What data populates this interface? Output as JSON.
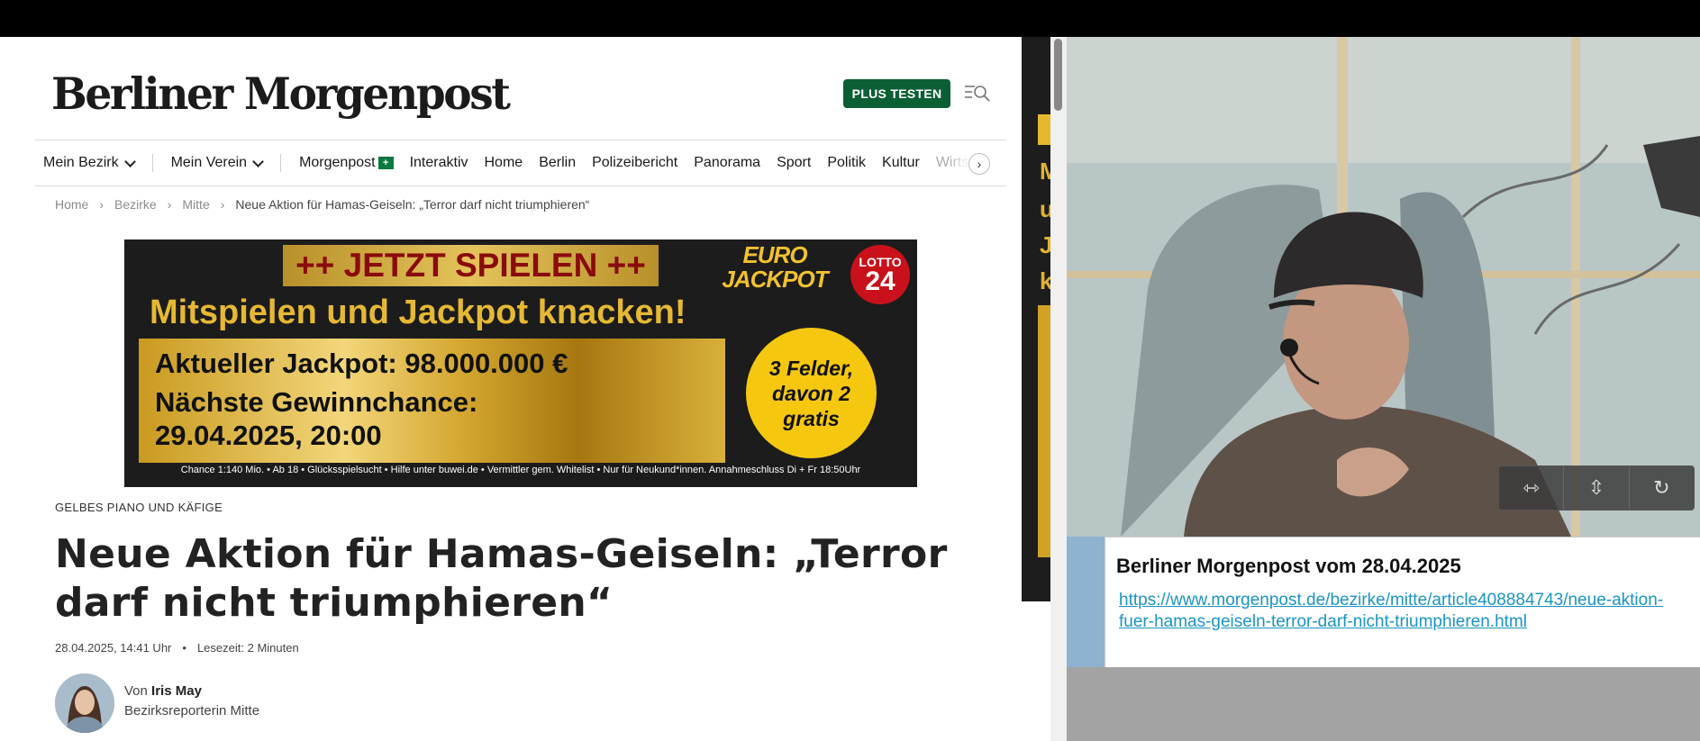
{
  "site": {
    "logo": "Berliner Morgenpost",
    "plus_button": "PLUS TESTEN"
  },
  "nav": {
    "items": [
      "Mein Bezirk",
      "Mein Verein",
      "Morgenpost",
      "Interaktiv",
      "Home",
      "Berlin",
      "Polizeibericht",
      "Panorama",
      "Sport",
      "Politik",
      "Kultur",
      "Wirts"
    ],
    "morgenpost_badge": "+"
  },
  "breadcrumb": [
    "Home",
    "Bezirke",
    "Mitte",
    "Neue Aktion für Hamas-Geiseln: „Terror darf nicht triumphieren“"
  ],
  "ad": {
    "banner": "++ JETZT SPIELEN ++",
    "subtitle": "Mitspielen und Jackpot knacken!",
    "line1": "Aktueller Jackpot: 98.000.000 €",
    "line2": "Nächste Gewinnchance:",
    "line3": "29.04.2025, 20:00",
    "circle": "3 Felder, davon 2 gratis",
    "eurojackpot": "EURO JACKPOT",
    "lotto_top": "LOTTO",
    "lotto_num": "24",
    "footer": "Chance 1:140 Mio. • Ab 18 • Glücksspielsucht • Hilfe unter buwei.de • Vermittler gem. Whitelist • Nur für Neukund*innen. Annahmeschluss Di + Fr 18:50Uhr"
  },
  "article": {
    "kicker": "GELBES PIANO UND KÄFIGE",
    "headline": "Neue Aktion für Hamas-Geiseln: „Terror darf nicht triumphieren“",
    "date": "28.04.2025, 14:41 Uhr",
    "read_time": "Lesezeit: 2 Minuten",
    "author_prefix": "Von",
    "author_name": "Iris May",
    "author_role": "Bezirksreporterin Mitte"
  },
  "video_card": {
    "title": "Berliner Morgenpost vom 28.04.2025",
    "link": "https://www.morgenpost.de/bezirke/mitte/article408884743/neue-aktion-fuer-hamas-geiseln-terror-darf-nicht-triumphieren.html"
  },
  "underlay_letters": [
    "M",
    "u",
    "J",
    "k"
  ],
  "colors": {
    "accent_green": "#0b5f34",
    "ad_gold": "#e6b833",
    "link_blue": "#1a95c4"
  }
}
